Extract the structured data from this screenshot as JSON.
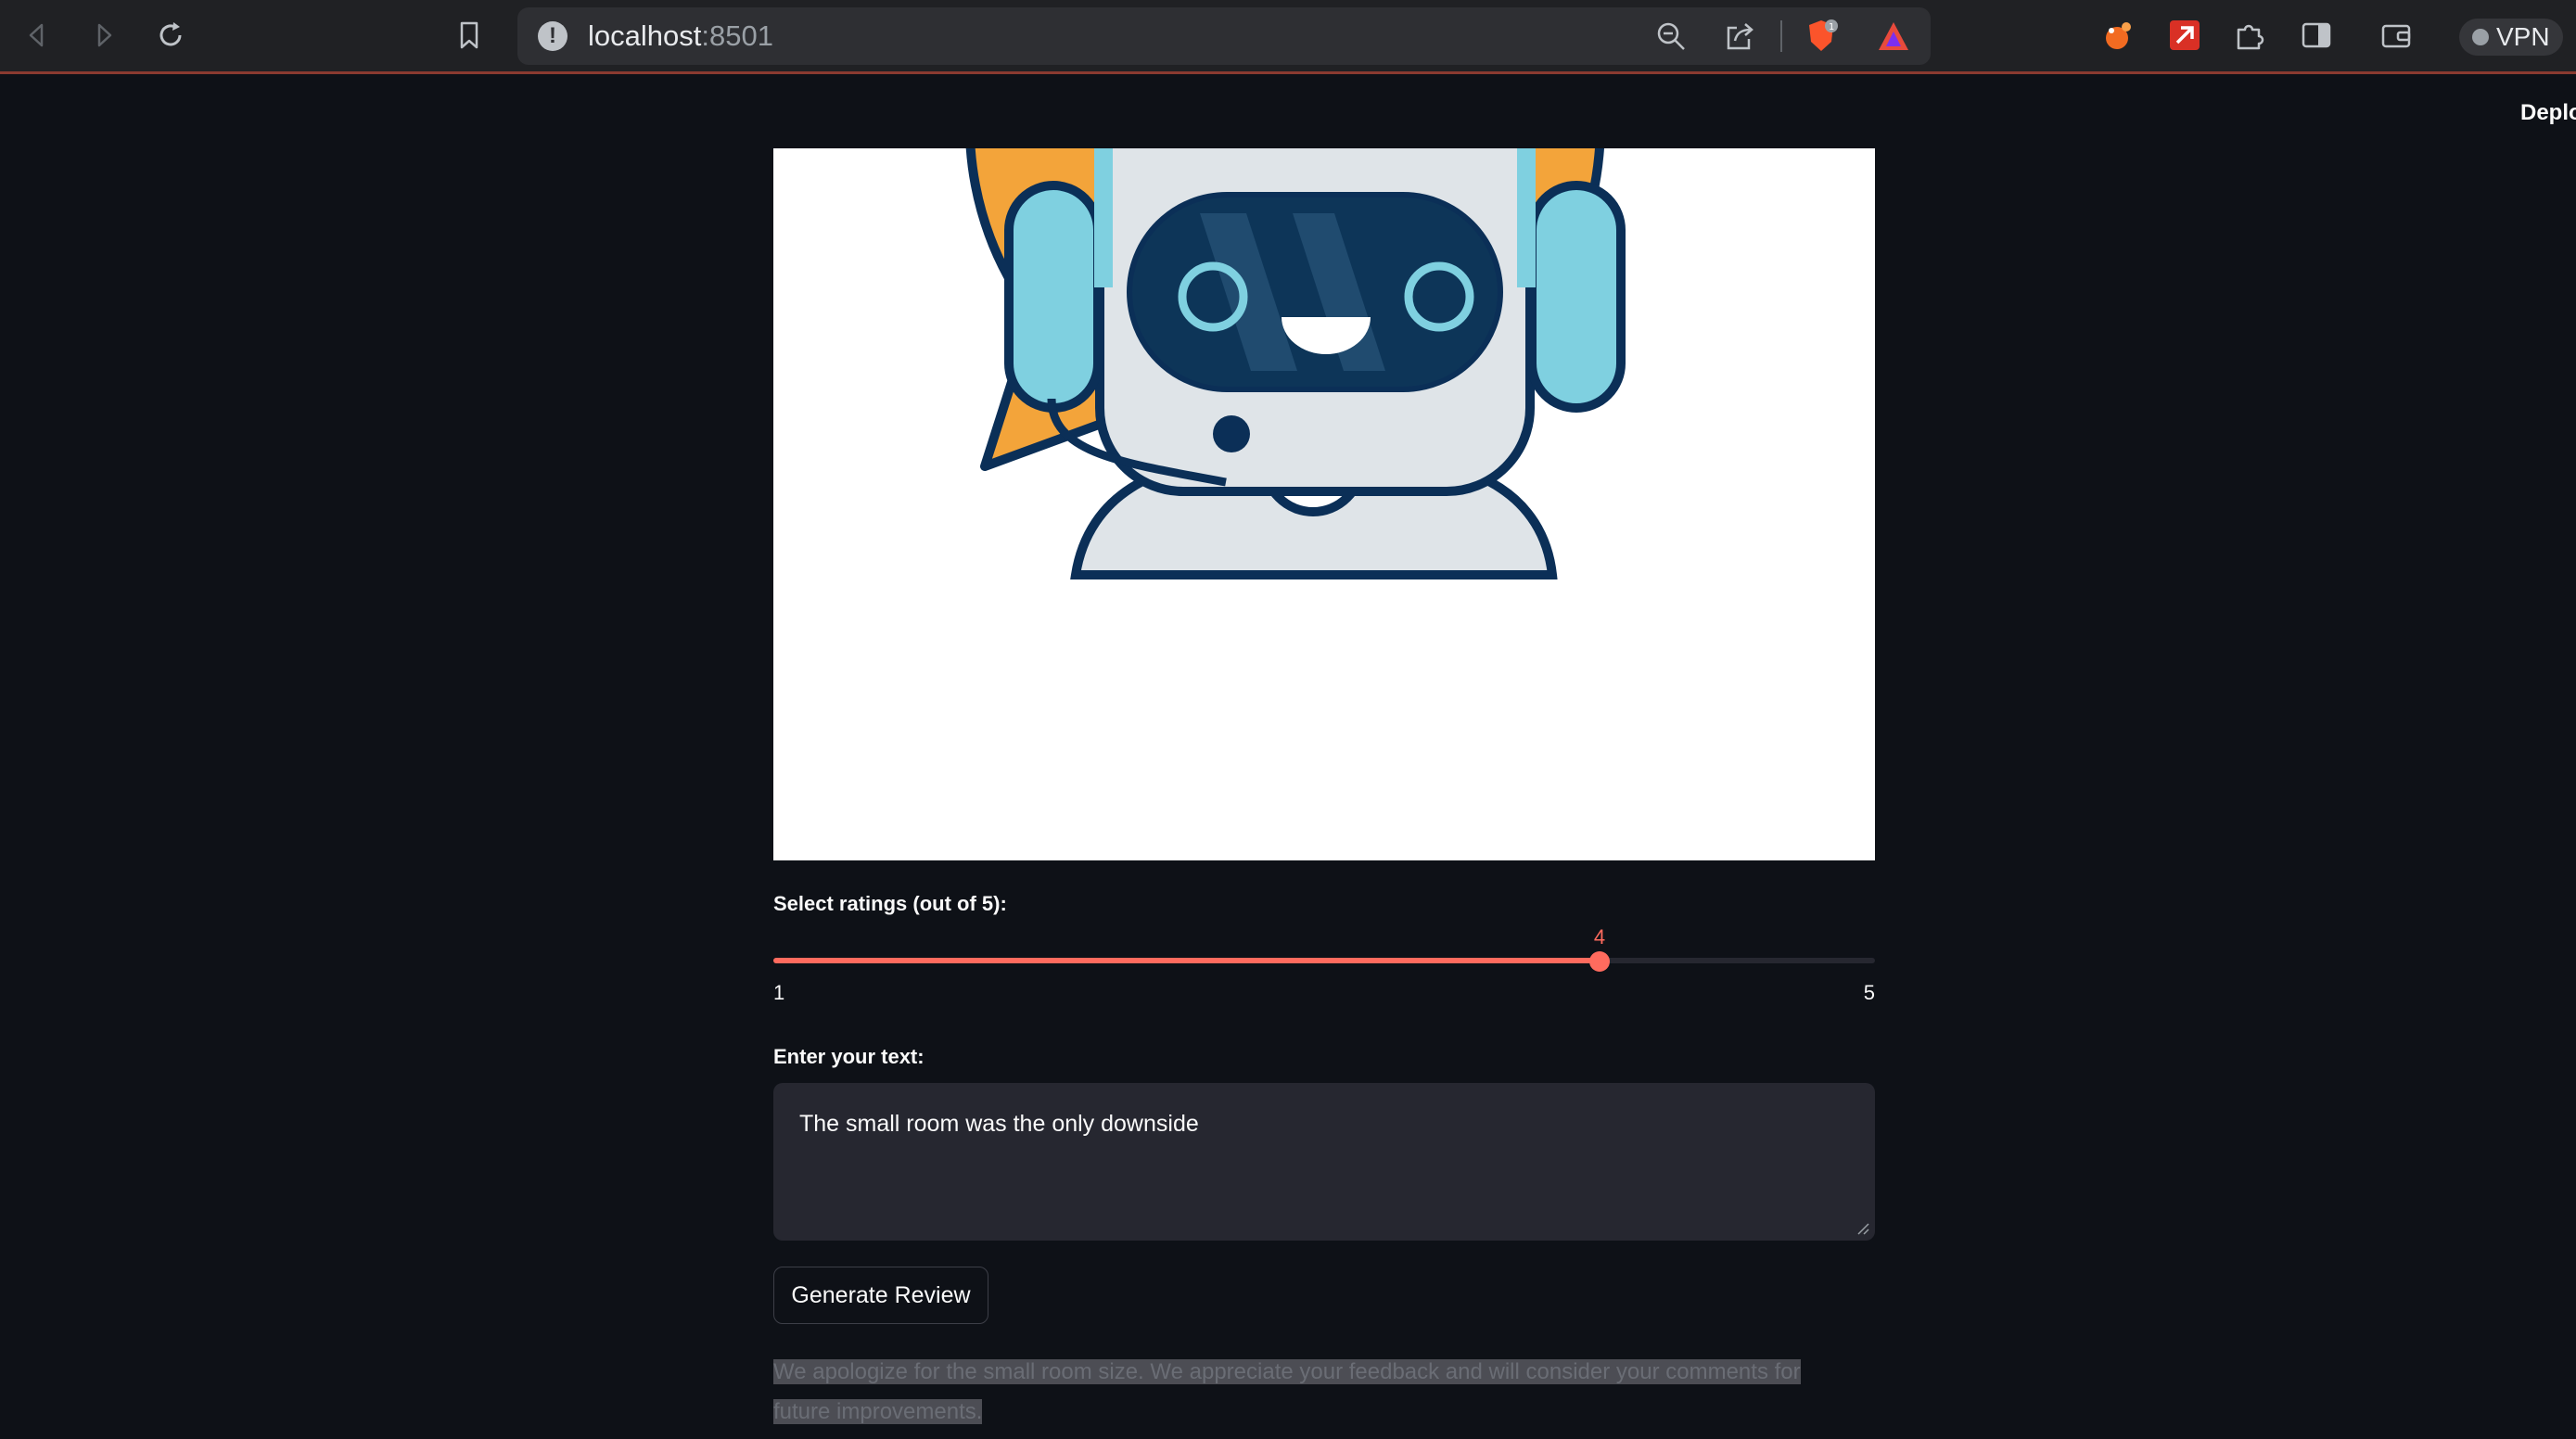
{
  "browser": {
    "url_host": "localhost",
    "url_port": ":8501",
    "vpn_label": "VPN"
  },
  "header": {
    "deploy_label": "Deplo"
  },
  "main": {
    "hero_image_alt": "robot-assistant-image",
    "rating": {
      "label": "Select ratings (out of 5):",
      "value": 4,
      "min": 1,
      "max": 5,
      "min_label": "1",
      "max_label": "5",
      "value_label": "4"
    },
    "text_input": {
      "label": "Enter your text:",
      "value": "The small room was the only downside"
    },
    "generate_button_label": "Generate Review",
    "output_text": "We apologize for the small room size. We appreciate your feedback and will consider your comments for future improvements."
  },
  "colors": {
    "accent": "#ff6b5e",
    "background": "#0e1117",
    "input_bg": "#262730"
  }
}
